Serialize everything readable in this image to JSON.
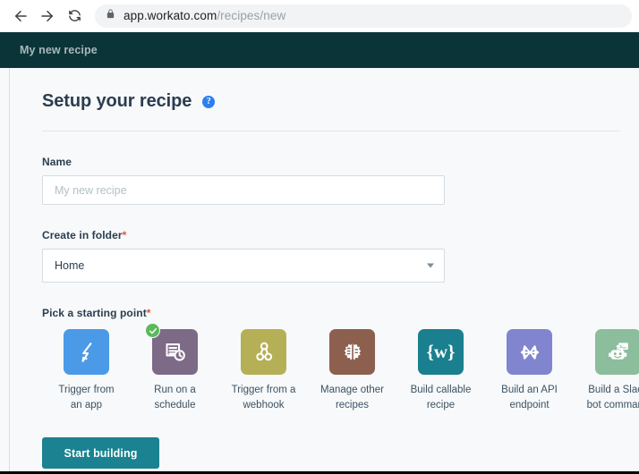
{
  "browser": {
    "back_icon": "arrow-left-icon",
    "forward_icon": "arrow-right-icon",
    "reload_icon": "reload-icon",
    "lock_icon": "lock-icon",
    "url_host": "app.workato.com",
    "url_path": "/recipes/new"
  },
  "app_topbar": {
    "title": "My new recipe",
    "background": "#0b3439"
  },
  "main": {
    "page_title": "Setup your recipe",
    "help_icon_label": "?",
    "name_field": {
      "label": "Name",
      "value": "",
      "placeholder": "My new recipe"
    },
    "folder_field": {
      "label": "Create in folder",
      "required_marker": "*",
      "value": "Home",
      "options": [
        "Home"
      ]
    },
    "starting_point": {
      "label": "Pick a starting point",
      "required_marker": "*",
      "cards": [
        {
          "label": "Trigger from an app",
          "line1": "Trigger from",
          "line2": "an app",
          "icon": "lightning-bolt-icon",
          "color": "#4a9ae8",
          "selected": false
        },
        {
          "label": "Run on a schedule",
          "line1": "Run on a",
          "line2": "schedule",
          "icon": "document-clock-icon",
          "color": "#7d6a86",
          "selected": true
        },
        {
          "label": "Trigger from a webhook",
          "line1": "Trigger from a",
          "line2": "webhook",
          "icon": "webhook-icon",
          "color": "#b5b055",
          "selected": false
        },
        {
          "label": "Manage other recipes",
          "line1": "Manage other",
          "line2": "recipes",
          "icon": "gear-recipes-icon",
          "color": "#8c5f4f",
          "selected": false
        },
        {
          "label": "Build callable recipe",
          "line1": "Build callable",
          "line2": "recipe",
          "icon": "workato-braces-icon",
          "color": "#1a7f8e",
          "selected": false
        },
        {
          "label": "Build an API endpoint",
          "line1": "Build an API",
          "line2": "endpoint",
          "icon": "api-endpoint-icon",
          "color": "#8185cf",
          "selected": false
        },
        {
          "label": "Build a Slack bot command",
          "line1": "Build a Slack",
          "line2": "bot command",
          "icon": "slack-bot-icon",
          "color": "#8cbd9d",
          "selected": false
        }
      ]
    },
    "start_button": {
      "label": "Start building",
      "color": "#1a8290"
    }
  }
}
